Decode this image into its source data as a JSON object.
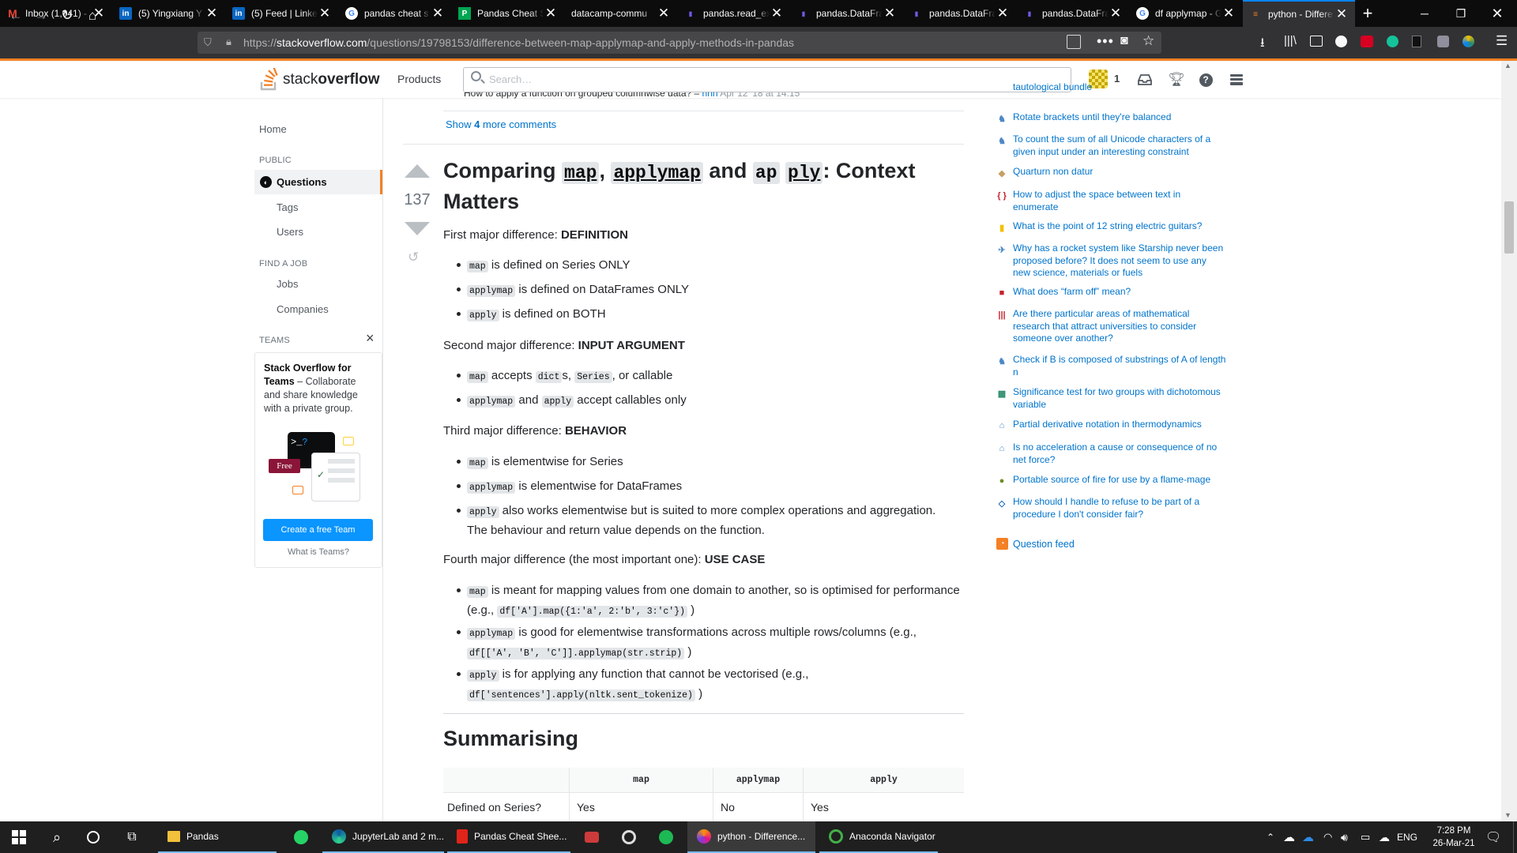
{
  "browser": {
    "tabs": [
      {
        "label": "Inbox (1,041) - ",
        "icon": "gmail-icon",
        "color": "#ea4335"
      },
      {
        "label": "(5) Yingxiang Y",
        "icon": "linkedin-icon",
        "color": "#0a66c2"
      },
      {
        "label": "(5) Feed | Linke",
        "icon": "linkedin-icon",
        "color": "#0a66c2"
      },
      {
        "label": "pandas cheat s",
        "icon": "google-icon",
        "color": "#ffffff"
      },
      {
        "label": "Pandas Cheat S",
        "icon": "pdf-green-icon",
        "color": "#00a651"
      },
      {
        "label": "datacamp-commu",
        "icon": "",
        "color": ""
      },
      {
        "label": "pandas.read_ex",
        "icon": "pandas-icon",
        "color": "#150458"
      },
      {
        "label": "pandas.DataFra",
        "icon": "pandas-icon",
        "color": "#150458"
      },
      {
        "label": "pandas.DataFra",
        "icon": "pandas-icon",
        "color": "#150458"
      },
      {
        "label": "pandas.DataFra",
        "icon": "pandas-icon",
        "color": "#150458"
      },
      {
        "label": "df applymap - G",
        "icon": "google-icon",
        "color": "#ffffff"
      },
      {
        "label": "python - Differe",
        "icon": "stackoverflow-icon",
        "color": "#f48024",
        "active": true
      }
    ],
    "url_prefix": "https://",
    "url_domain": "stackoverflow.com",
    "url_path": "/questions/19798153/difference-between-map-applymap-and-apply-methods-in-pandas"
  },
  "so_header": {
    "logo_light": "stack",
    "logo_bold": "overflow",
    "products": "Products",
    "search_placeholder": "Search…",
    "rep_count": "1"
  },
  "left_nav": {
    "home": "Home",
    "public_label": "PUBLIC",
    "questions": "Questions",
    "tags": "Tags",
    "users": "Users",
    "find_job_label": "FIND A JOB",
    "jobs": "Jobs",
    "companies": "Companies",
    "teams_label": "TEAMS",
    "teams_close": "×",
    "teams_title": "Stack Overflow for Teams",
    "teams_desc": " – Collaborate and share knowledge with a private group.",
    "free_badge": "Free",
    "create_team": "Create a free Team",
    "what_is_teams": "What is Teams?"
  },
  "post": {
    "prev_comment": "How to apply a function on grouped columnwise data? – ",
    "prev_comment_user": "hhh",
    "prev_comment_time": " Apr 12 '18 at 14:15",
    "show_more_prefix": "Show ",
    "show_more_count": "4",
    "show_more_suffix": " more comments",
    "vote_count": "137",
    "title_1": "Comparing ",
    "title_code_1": "map",
    "title_2": ", ",
    "title_code_2": "applymap",
    "title_3": " and ",
    "title_code_3a": "ap",
    "title_code_3b": "ply",
    "title_4": ": Context Matters",
    "s1_prefix": "First major difference: ",
    "s1_bold": "DEFINITION",
    "s1_items": [
      {
        "code": "map",
        "text": " is defined on Series ONLY"
      },
      {
        "code": "applymap",
        "text": " is defined on DataFrames ONLY"
      },
      {
        "code": "apply",
        "text": " is defined on BOTH"
      }
    ],
    "s2_prefix": "Second major difference: ",
    "s2_bold": "INPUT ARGUMENT",
    "s2_i1_code": "map",
    "s2_i1_t1": " accepts ",
    "s2_i1_code2": "dict",
    "s2_i1_t2": "s, ",
    "s2_i1_code3": "Series",
    "s2_i1_t3": ", or callable",
    "s2_i2_code": "applymap",
    "s2_i2_t1": " and ",
    "s2_i2_code2": "apply",
    "s2_i2_t2": " accept callables only",
    "s3_prefix": "Third major difference: ",
    "s3_bold": "BEHAVIOR",
    "s3_i1_code": "map",
    "s3_i1_text": " is elementwise for Series",
    "s3_i2_code": "applymap",
    "s3_i2_text": " is elementwise for DataFrames",
    "s3_i3_code": "apply",
    "s3_i3_text": " also works elementwise but is suited to more complex operations and aggregation. The behaviour and return value depends on the function.",
    "s4_prefix": "Fourth major difference (the most important one): ",
    "s4_bold": "USE CASE",
    "s4_i1_code": "map",
    "s4_i1_text": " is meant for mapping values from one domain to another, so is optimised for performance (e.g., ",
    "s4_i1_code2": "df['A'].map({1:'a', 2:'b', 3:'c'})",
    "s4_i1_end": " )",
    "s4_i2_code": "applymap",
    "s4_i2_text": " is good for elementwise transformations across multiple rows/columns (e.g., ",
    "s4_i2_code2": "df[['A', 'B', 'C']].applymap(str.strip)",
    "s4_i2_end": " )",
    "s4_i3_code": "apply",
    "s4_i3_text": " is for applying any function that cannot be vectorised (e.g., ",
    "s4_i3_code2": "df['sentences'].apply(nltk.sent_tokenize)",
    "s4_i3_end": " )",
    "summary_heading": "Summarising",
    "table_headers": [
      "",
      "map",
      "applymap",
      "apply"
    ],
    "table_row": [
      "Defined on Series?",
      "Yes",
      "No",
      "Yes"
    ]
  },
  "hot_questions": [
    {
      "title": "tautological bundle",
      "icon": "math-icon",
      "color": "#4e88c7"
    },
    {
      "title": "Rotate brackets until they're balanced",
      "icon": "codegolf-icon",
      "color": "#4e88c7"
    },
    {
      "title": "To count the sum of all Unicode characters of a given input under an interesting constraint",
      "icon": "codegolf-icon",
      "color": "#4e88c7"
    },
    {
      "title": "Quarturn non datur",
      "icon": "puzzling-icon",
      "color": "#c89f64"
    },
    {
      "title": "How to adjust the space between text in enumerate",
      "icon": "tex-icon",
      "color": "#c3232e"
    },
    {
      "title": "What is the point of 12 string electric guitars?",
      "icon": "music-icon",
      "color": "#f4c000"
    },
    {
      "title": "Why has a rocket system like Starship never been proposed before? It does not seem to use any new science, materials or fuels",
      "icon": "space-icon",
      "color": "#4e88c7"
    },
    {
      "title": "What does “farm off” mean?",
      "icon": "english-icon",
      "color": "#c3232e"
    },
    {
      "title": "Are there particular areas of mathematical research that attract universities to consider someone over another?",
      "icon": "academia-icon",
      "color": "#c3232e"
    },
    {
      "title": "Check if B is composed of substrings of A of length n",
      "icon": "codegolf-icon",
      "color": "#4e88c7"
    },
    {
      "title": "Significance test for two groups with dichotomous variable",
      "icon": "stats-icon",
      "color": "#2a8b6a"
    },
    {
      "title": "Partial derivative notation in thermodynamics",
      "icon": "physics-icon",
      "color": "#4e88c7"
    },
    {
      "title": "Is no acceleration a cause or consequence of no net force?",
      "icon": "physics-icon",
      "color": "#4e88c7"
    },
    {
      "title": "Portable source of fire for use by a flame-mage",
      "icon": "worldbuilding-icon",
      "color": "#6b8e23"
    },
    {
      "title": "How should I handle to refuse to be part of a procedure I don't consider fair?",
      "icon": "workplace-icon",
      "color": "#1e6cb6"
    }
  ],
  "question_feed": "Question feed",
  "taskbar": {
    "apps": [
      {
        "label": "Pandas",
        "icon": "folder-icon"
      },
      {
        "label": "",
        "icon": "whatsapp-icon"
      },
      {
        "label": "JupyterLab and 2 m...",
        "icon": "edge-icon"
      },
      {
        "label": "Pandas Cheat Shee...",
        "icon": "pdf-icon"
      },
      {
        "label": "",
        "icon": "snipping-icon"
      },
      {
        "label": "",
        "icon": "media-icon"
      },
      {
        "label": "",
        "icon": "spotify-icon"
      },
      {
        "label": "python - Difference...",
        "icon": "firefox-icon"
      },
      {
        "label": "Anaconda Navigator",
        "icon": "anaconda-icon"
      }
    ],
    "lang": "ENG",
    "time": "7:28 PM",
    "date": "26-Mar-21"
  }
}
